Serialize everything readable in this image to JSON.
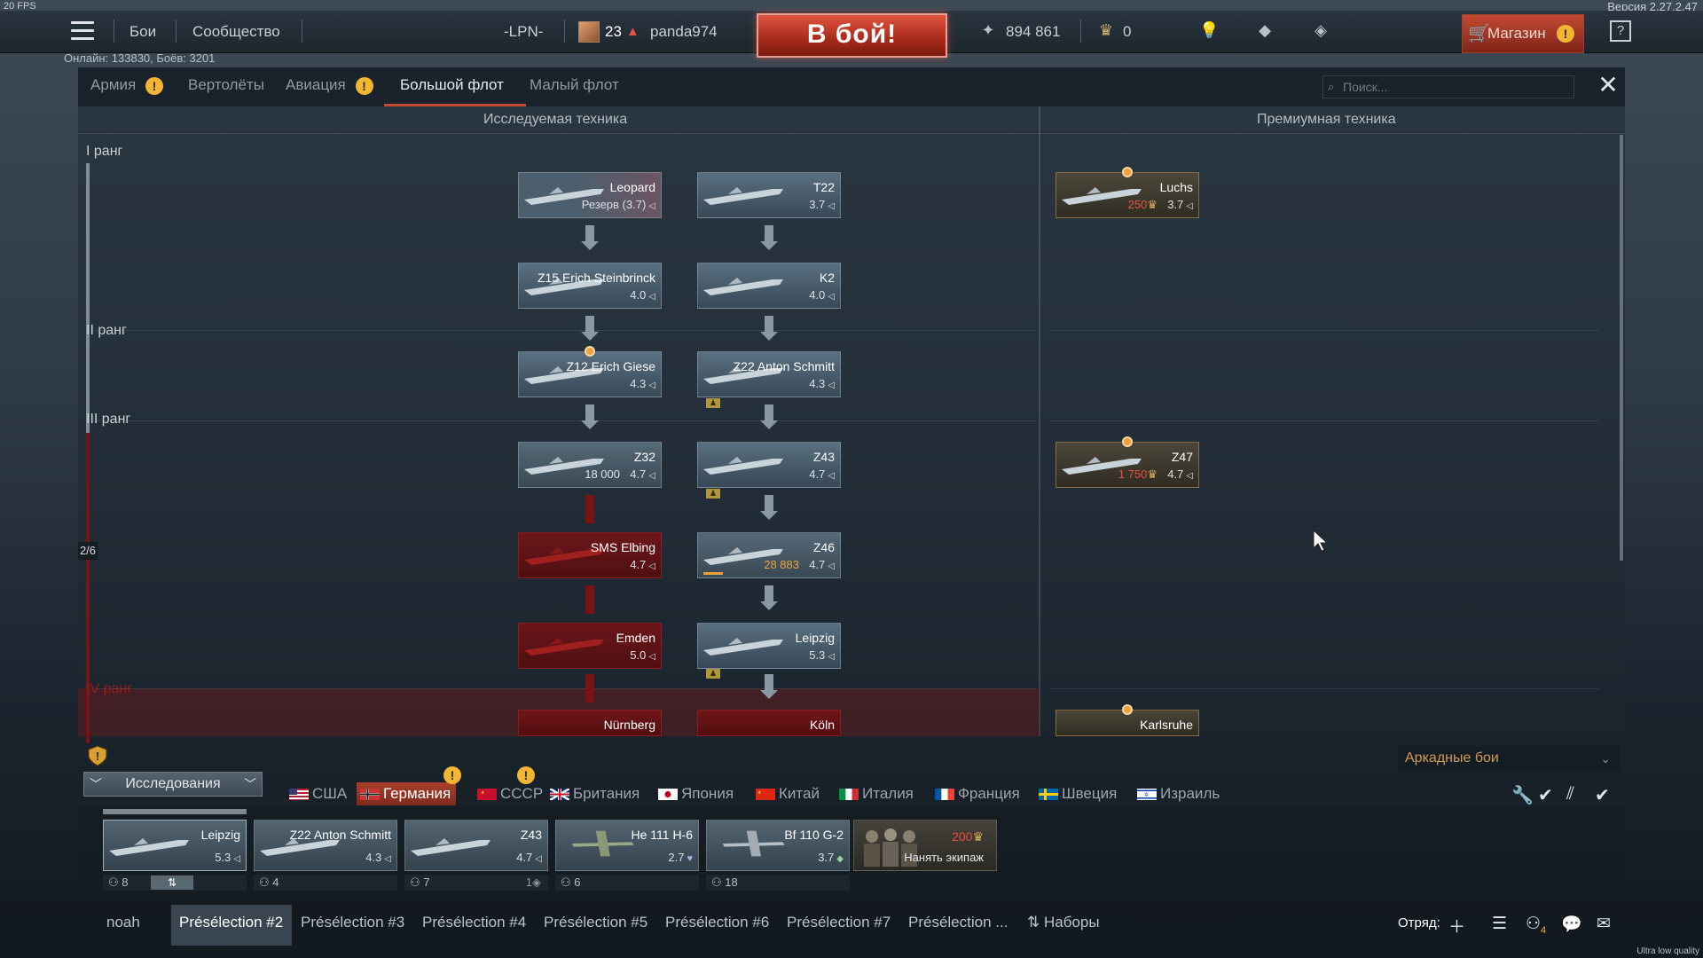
{
  "hud": {
    "fps": "20 FPS",
    "version": "Версия 2.27.2.47",
    "quality": "Ultra low quality",
    "online": "Онлайн: 133830, Боёв: 3201"
  },
  "topbar": {
    "menu": [
      "Бои",
      "Сообщество"
    ],
    "clan": "-LPN-",
    "level": "23",
    "username": "panda974",
    "battle_button": "В бой!",
    "silver_lions": "894 861",
    "golden_eagles": "0",
    "shop": "Магазин"
  },
  "tabs": [
    {
      "label": "Армия",
      "warn": "!"
    },
    {
      "label": "Вертолёты"
    },
    {
      "label": "Авиация",
      "warn": "!"
    },
    {
      "label": "Большой флот",
      "active": true
    },
    {
      "label": "Малый флот"
    }
  ],
  "search_placeholder": "Поиск...",
  "columns": {
    "research": "Исследуемая техника",
    "premium": "Премиумная техника"
  },
  "ranks": [
    "I ранг",
    "II ранг",
    "III ранг",
    "IV ранг"
  ],
  "rank_counter": "2/6",
  "vehicles": [
    {
      "id": "leopard",
      "name": "Leopard",
      "br": "Резерв (3.7)",
      "state": "reserve"
    },
    {
      "id": "t22",
      "name": "T22",
      "br": "3.7",
      "state": "researched"
    },
    {
      "id": "z15",
      "name": "Z15 Erich Steinbrinck",
      "br": "4.0",
      "state": "researched"
    },
    {
      "id": "k2",
      "name": "K2",
      "br": "4.0",
      "state": "researched"
    },
    {
      "id": "z12",
      "name": "Z12 Erich Giese",
      "br": "4.3",
      "state": "researched"
    },
    {
      "id": "z22",
      "name": "Z22 Anton Schmitt",
      "br": "4.3",
      "state": "researched"
    },
    {
      "id": "z32",
      "name": "Z32",
      "br": "4.7",
      "cost": "18 000",
      "state": "available"
    },
    {
      "id": "z43",
      "name": "Z43",
      "br": "4.7",
      "state": "researched"
    },
    {
      "id": "elbing",
      "name": "SMS Elbing",
      "br": "4.7",
      "state": "locked"
    },
    {
      "id": "z46",
      "name": "Z46",
      "br": "4.7",
      "cost": "28 883",
      "state": "researching"
    },
    {
      "id": "emden",
      "name": "Emden",
      "br": "5.0",
      "state": "locked"
    },
    {
      "id": "leipzig",
      "name": "Leipzig",
      "br": "5.3",
      "state": "researched"
    },
    {
      "id": "nurnberg",
      "name": "Nürnberg",
      "br": "",
      "state": "locked"
    },
    {
      "id": "koln",
      "name": "Köln",
      "br": "",
      "state": "locked"
    },
    {
      "id": "luchs",
      "name": "Luchs",
      "br": "3.7",
      "cost": "250",
      "state": "premium"
    },
    {
      "id": "z47",
      "name": "Z47",
      "br": "4.7",
      "cost": "1 750",
      "state": "premium"
    },
    {
      "id": "karlsruhe",
      "name": "Karlsruhe",
      "br": "",
      "state": "premium"
    }
  ],
  "game_mode": "Аркадные бои",
  "research_button": "Исследования",
  "nations": [
    {
      "label": "США"
    },
    {
      "label": "Германия",
      "active": true,
      "warn": "!"
    },
    {
      "label": "СССР",
      "warn": "!"
    },
    {
      "label": "Британия"
    },
    {
      "label": "Япония"
    },
    {
      "label": "Китай"
    },
    {
      "label": "Италия"
    },
    {
      "label": "Франция"
    },
    {
      "label": "Швеция"
    },
    {
      "label": "Израиль"
    }
  ],
  "crew_slots": [
    {
      "name": "Leipzig",
      "br": "5.3",
      "crew": "8"
    },
    {
      "name": "Z22 Anton Schmitt",
      "br": "4.3",
      "crew": "4"
    },
    {
      "name": "Z43",
      "br": "4.7",
      "crew": "7",
      "extra": "1"
    },
    {
      "name": "He 111 H-6",
      "br": "2.7",
      "crew": "6"
    },
    {
      "name": "Bf 110 G-2",
      "br": "3.7",
      "crew": "18"
    }
  ],
  "hire": {
    "cost": "200",
    "label": "Нанять экипаж"
  },
  "presets": [
    "noah",
    "Présélection #2",
    "Présélection #3",
    "Présélection #4",
    "Présélection #5",
    "Présélection #6",
    "Présélection #7",
    "Présélection ..."
  ],
  "sets_label": "Наборы",
  "squad_label": "Отряд:",
  "squad_count": "4",
  "colors": {
    "accent": "#c34a30",
    "battle": "#c0392b",
    "warn": "#f2b534",
    "locked": "#7a1414",
    "cost": "#e9a23c"
  }
}
